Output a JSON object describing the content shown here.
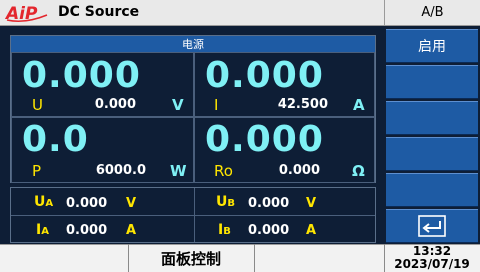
{
  "header": {
    "logo_text": "AiP",
    "title": "DC Source",
    "mode": "A/B"
  },
  "panel": {
    "title": "电源",
    "cells": [
      {
        "big": "0.000",
        "label": "U",
        "value": "0.000",
        "unit": "V"
      },
      {
        "big": "0.000",
        "label": "I",
        "value": "42.500",
        "unit": "A"
      },
      {
        "big": "0.0",
        "label": "P",
        "value": "6000.0",
        "unit": "W"
      },
      {
        "big": "0.000",
        "label": "Ro",
        "value": "0.000",
        "unit": "Ω"
      }
    ]
  },
  "channels": {
    "ua": {
      "label": "U",
      "sub": "A",
      "value": "0.000",
      "unit": "V"
    },
    "ub": {
      "label": "U",
      "sub": "B",
      "value": "0.000",
      "unit": "V"
    },
    "ia": {
      "label": "I",
      "sub": "A",
      "value": "0.000",
      "unit": "A"
    },
    "ib": {
      "label": "I",
      "sub": "B",
      "value": "0.000",
      "unit": "A"
    }
  },
  "side": {
    "enable_label": "启用",
    "back_icon": "return-arrow-icon"
  },
  "footer": {
    "panel_control": "面板控制",
    "time": "13:32",
    "date": "2023/07/19"
  },
  "colors": {
    "background": "#0e1e36",
    "accent": "#1e5ba4",
    "big_digits": "#7ff0f5",
    "labels": "#ffe600",
    "logo": "#e3262d"
  }
}
